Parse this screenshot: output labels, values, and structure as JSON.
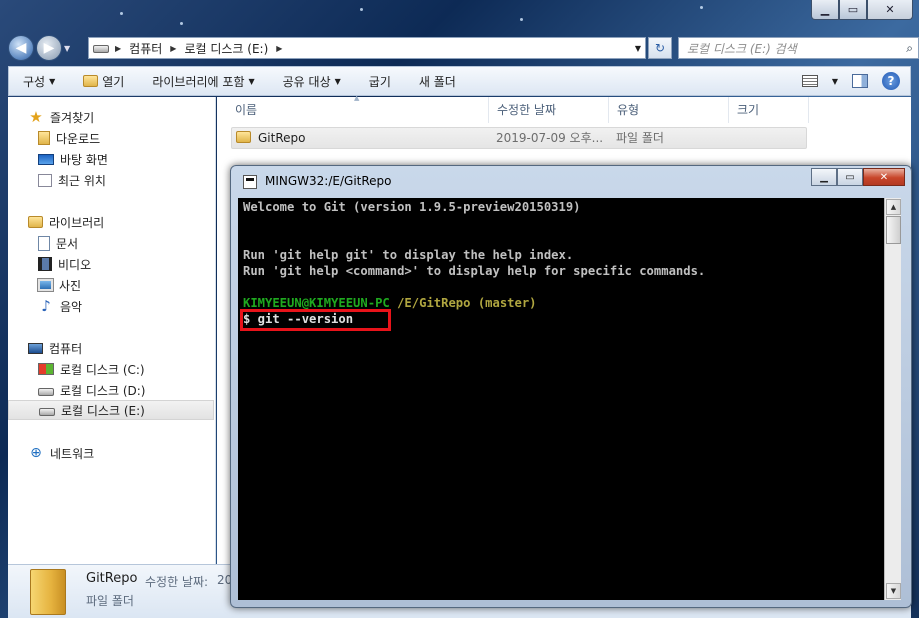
{
  "explorer": {
    "address": {
      "segments": [
        "컴퓨터",
        "로컬 디스크 (E:)"
      ]
    },
    "search": {
      "placeholder": "로컬 디스크 (E:) 검색"
    },
    "commands": [
      "구성",
      "열기",
      "라이브러리에 포함",
      "공유 대상",
      "굽기",
      "새 폴더"
    ],
    "nav": {
      "favorites": {
        "label": "즐겨찾기",
        "items": [
          "다운로드",
          "바탕 화면",
          "최근 위치"
        ]
      },
      "libraries": {
        "label": "라이브러리",
        "items": [
          "문서",
          "비디오",
          "사진",
          "음악"
        ]
      },
      "computer": {
        "label": "컴퓨터",
        "items": [
          "로컬 디스크 (C:)",
          "로컬 디스크 (D:)",
          "로컬 디스크 (E:)"
        ]
      },
      "network": {
        "label": "네트워크"
      }
    },
    "columns": [
      "이름",
      "수정한 날짜",
      "유형",
      "크기"
    ],
    "files": [
      {
        "name": "GitRepo",
        "modified": "2019-07-09 오후...",
        "type": "파일 폴더",
        "size": ""
      }
    ],
    "details": {
      "name": "GitRepo",
      "modified_label": "수정한 날짜:",
      "modified_value": "2019-07-09",
      "type": "파일 폴더"
    }
  },
  "git_window": {
    "title": "MINGW32:/E/GitRepo",
    "lines": [
      "Welcome to Git (version 1.9.5-preview20150319)",
      "Run 'git help git' to display the help index.",
      "Run 'git help <command>' to display help for specific commands."
    ],
    "prompt_user": "KIMYEEUN@KIMYEEUN-PC",
    "prompt_path": "/E/GitRepo",
    "prompt_branch": "(master)",
    "command": "$ git --version"
  },
  "colors": {
    "highlight_box": "#e8131a",
    "terminal_bg": "#000000",
    "terminal_text": "#c0c0c0",
    "prompt_green": "#1fa91f"
  }
}
